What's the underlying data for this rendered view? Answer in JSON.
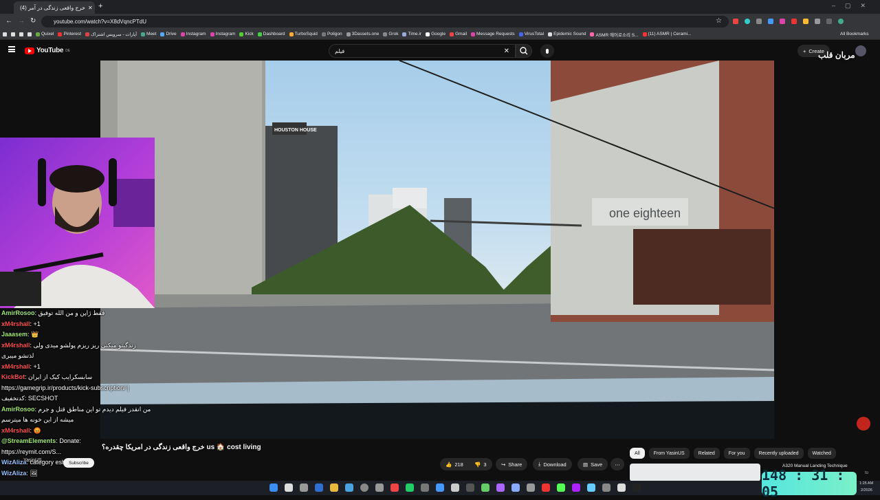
{
  "browser": {
    "tab_title": "(4) خرج واقعی زندگی در آمر",
    "url": "youtube.com/watch?v=X8dVqncPTdU",
    "bookmarks": [
      "Quixel",
      "Pinterest",
      "آپارات - سرویس اشتراک",
      "Meet",
      "Drive",
      "Instagram",
      "Instagram",
      "Kick",
      "Dashboard",
      "TurboSquid",
      "Poligon",
      "3Dassets.one",
      "Grok",
      "Time.ir",
      "Google",
      "Gmail",
      "Message Requests",
      "VirusTotal",
      "Epidemic Sound",
      "ASMR 에어로소리 S...",
      "(11) ASMR | Cerami..."
    ],
    "all_bookmarks": "All Bookmarks"
  },
  "youtube": {
    "logo": "YouTube",
    "logo_sup": "DE",
    "search_value": "فیلم",
    "create_label": "Create",
    "overlay_brand": "مربان قلب"
  },
  "video": {
    "title": "خرج واقعی زندگی در امریکا چقدره؟ us 🏠 cost living",
    "channel": "YasinUS",
    "subscribe": "Subscribe",
    "likes": "218",
    "dislikes": "3",
    "share": "Share",
    "download": "Download",
    "save": "Save",
    "building_sign": "HOUSTON HOUSE",
    "store_sign": "one eighteen"
  },
  "chips": [
    "All",
    "From YasinUS",
    "Related",
    "For you",
    "Recently uploaded",
    "Watched"
  ],
  "recommended": {
    "title": "A320 Manual Landing Technique",
    "side_text": "to"
  },
  "chat": [
    {
      "nick": "AmirRosoo",
      "color": "g",
      "text": "فقط ژاپن و من الله توفیق"
    },
    {
      "nick": "xM4rshall",
      "color": "r",
      "text": "+1"
    },
    {
      "nick": "Jaaasem",
      "color": "g",
      "text": "👑"
    },
    {
      "nick": "xM4rshall",
      "color": "r",
      "text": "زندگیتو میکنی ریز ریزم پولشو میدی ولی"
    },
    {
      "nick": "",
      "color": "",
      "text": "لذتشو میبری"
    },
    {
      "nick": "xM4rshall",
      "color": "r",
      "text": "+1"
    },
    {
      "nick": "KickBot",
      "color": "r",
      "text": "سابسکرایب کیک از ایران"
    },
    {
      "nick": "",
      "color": "",
      "text": "https://gamegrip.ir/products/kick-subscription/ |"
    },
    {
      "nick": "",
      "color": "",
      "text": "کدتخفیف: SECSHOT"
    },
    {
      "nick": "AmirRosoo",
      "color": "g",
      "text": "من انقدر فیلم دیدم تو این مناطق قتل و جرم"
    },
    {
      "nick": "",
      "color": "",
      "text": "میشه از این خونه ها میترسم"
    },
    {
      "nick": "xM4rshall",
      "color": "r",
      "text": "😡"
    },
    {
      "nick": "@StreamElements",
      "color": "g",
      "text": "Donate:"
    },
    {
      "nick": "",
      "color": "",
      "text": "https://reymit.com/S..."
    },
    {
      "nick": "WizAliza",
      "color": "b",
      "text": "category eshtebahe"
    },
    {
      "nick": "WizAliza",
      "color": "b",
      "text": "🖼"
    }
  ],
  "timer": "148 : 31 : 05",
  "tray": {
    "time": "1:25 AM",
    "date": "2/2026"
  }
}
